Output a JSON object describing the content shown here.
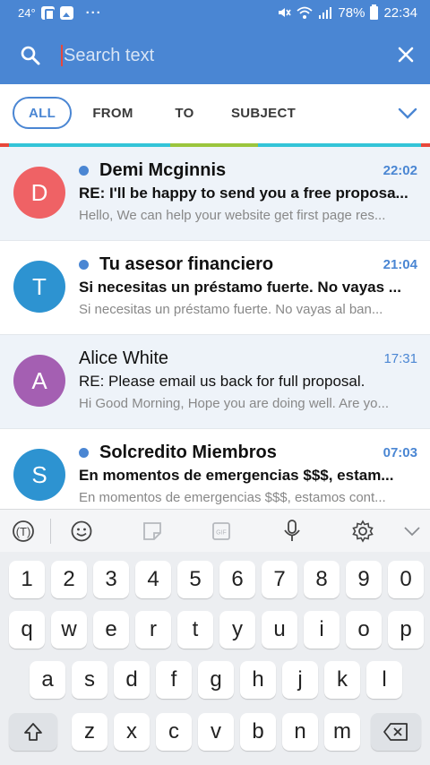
{
  "status_bar": {
    "temperature": "24°",
    "dots": "···",
    "battery_percent": "78%",
    "time": "22:34"
  },
  "search": {
    "placeholder": "Search text",
    "value": ""
  },
  "filters": {
    "tabs": [
      "ALL",
      "FROM",
      "TO",
      "SUBJECT"
    ],
    "active": "ALL"
  },
  "stripe_colors": [
    "#e8473b",
    "#33c4d8",
    "#9bc53d",
    "#33c4d8",
    "#e8473b"
  ],
  "mails": [
    {
      "initial": "D",
      "avatar_color": "#ef6265",
      "sender": "Demi Mcginnis",
      "time": "22:02",
      "subject": "RE: I'll be happy to send you a free proposa...",
      "preview": "Hello, We can help your website get first page res...",
      "unread": true
    },
    {
      "initial": "T",
      "avatar_color": "#2d93d1",
      "sender": "Tu asesor financiero",
      "time": "21:04",
      "subject": "Si necesitas un préstamo fuerte. No vayas ...",
      "preview": "Si necesitas un préstamo fuerte. No vayas al ban...",
      "unread": true
    },
    {
      "initial": "A",
      "avatar_color": "#a45fb2",
      "sender": "Alice White",
      "time": "17:31",
      "subject": "RE: Please email us back for full proposal.",
      "preview": "Hi Good Morning, Hope you are doing well. Are yo...",
      "unread": false
    },
    {
      "initial": "S",
      "avatar_color": "#2d93d1",
      "sender": "Solcredito Miembros",
      "time": "07:03",
      "subject": "En momentos de emergencias $$$, estam...",
      "preview": "En momentos de emergencias $$$, estamos cont...",
      "unread": true
    }
  ],
  "keyboard": {
    "toolbar_icons": [
      "text-recognition-icon",
      "emoji-icon",
      "sticker-icon",
      "gif-icon",
      "microphone-icon",
      "settings-gear-icon",
      "chevron-down-icon"
    ],
    "row_numbers": [
      "1",
      "2",
      "3",
      "4",
      "5",
      "6",
      "7",
      "8",
      "9",
      "0"
    ],
    "row_top": [
      "q",
      "w",
      "e",
      "r",
      "t",
      "y",
      "u",
      "i",
      "o",
      "p"
    ],
    "row_middle": [
      "a",
      "s",
      "d",
      "f",
      "g",
      "h",
      "j",
      "k",
      "l"
    ],
    "row_bottom": [
      "z",
      "x",
      "c",
      "v",
      "b",
      "n",
      "m"
    ],
    "shift_icon": "shift-icon",
    "backspace_icon": "backspace-icon"
  }
}
